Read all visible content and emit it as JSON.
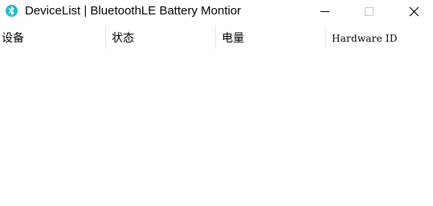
{
  "window": {
    "title": "DeviceList | BluetoothLE Battery Montior",
    "icon": "bluetooth-icon",
    "accent_color": "#21b7c9"
  },
  "caption_buttons": {
    "minimize": "minimize-icon",
    "maximize": "maximize-icon",
    "close": "close-icon"
  },
  "listview": {
    "columns": [
      {
        "label": "设备"
      },
      {
        "label": "状态"
      },
      {
        "label": "电量"
      },
      {
        "label": "Hardware ID"
      }
    ],
    "rows": []
  }
}
